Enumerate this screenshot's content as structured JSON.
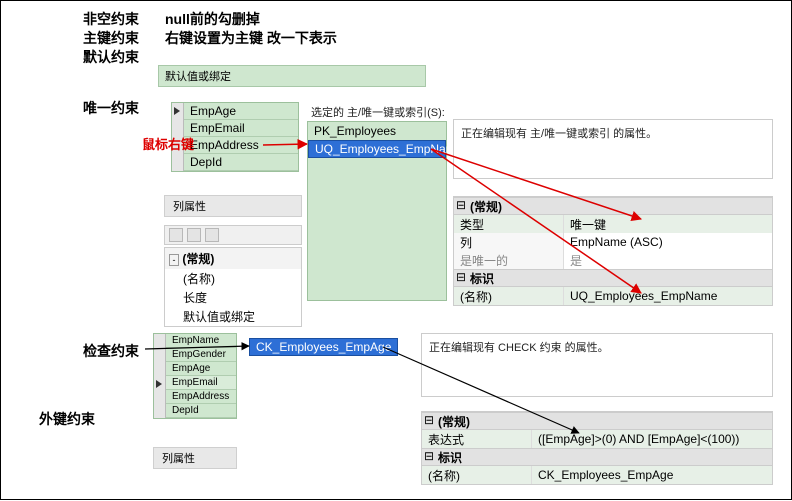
{
  "constraints": {
    "notnull": {
      "label": "非空约束",
      "desc": "null前的勾删掉"
    },
    "primary": {
      "label": "主键约束",
      "desc": "右键设置为主键  改一下表示"
    },
    "default": {
      "label": "默认约束",
      "desc": "默认值或绑定"
    },
    "unique": {
      "label": "唯一约束"
    },
    "rightclick": {
      "label": "鼠标右键"
    },
    "check": {
      "label": "检查约束"
    },
    "foreign": {
      "label": "外键约束"
    }
  },
  "unique_panel": {
    "cols1": [
      "EmpAge",
      "EmpEmail",
      "EmpAddress",
      "DepId"
    ],
    "cols_prop_title": "列属性",
    "tree_title": "(常规)",
    "tree_items": [
      "(名称)",
      "长度",
      "默认值或绑定"
    ],
    "picker_label": "选定的 主/唯一键或索引(S):",
    "items": [
      "PK_Employees",
      "UQ_Employees_EmpName"
    ],
    "right_desc": "正在编辑现有 主/唯一键或索引 的属性。",
    "grid": {
      "sec1": "(常规)",
      "r1k": "类型",
      "r1v": "唯一键",
      "r2k": "列",
      "r2v": "EmpName (ASC)",
      "r3k": "是唯一的",
      "r3v": "是",
      "sec2": "标识",
      "r4k": "(名称)",
      "r4v": "UQ_Employees_EmpName"
    }
  },
  "check_panel": {
    "cols1": [
      "EmpName",
      "EmpGender",
      "EmpAge",
      "EmpEmail",
      "EmpAddress",
      "DepId"
    ],
    "cols_prop_title": "列属性",
    "item": "CK_Employees_EmpAge",
    "right_desc": "正在编辑现有 CHECK 约束 的属性。",
    "grid": {
      "sec1": "(常规)",
      "r1k": "表达式",
      "r1v": "([EmpAge]>(0) AND [EmpAge]<(100))",
      "sec2": "标识",
      "r2k": "(名称)",
      "r2v": "CK_Employees_EmpAge"
    }
  }
}
